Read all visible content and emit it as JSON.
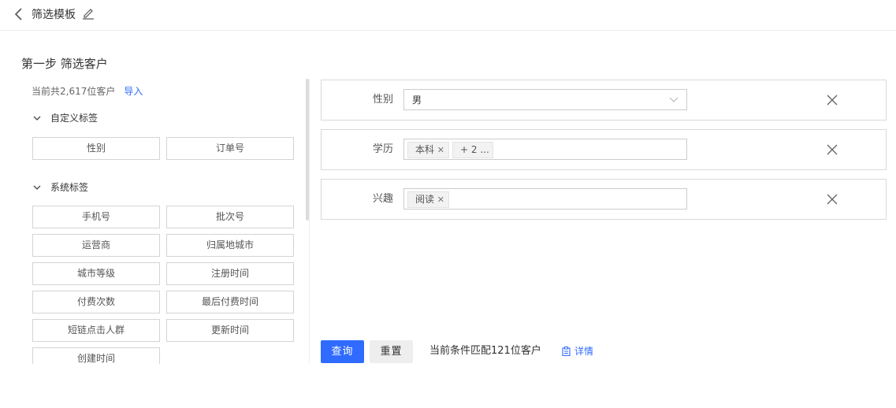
{
  "header": {
    "title": "筛选模板",
    "back_icon": "chevron-left-icon",
    "edit_icon": "pencil-icon"
  },
  "step": {
    "title": "第一步 筛选客户"
  },
  "left": {
    "count_text": "当前共2,617位客户",
    "import_label": "导入",
    "custom_group": {
      "label": "自定义标签",
      "tags": [
        "性别",
        "订单号"
      ]
    },
    "system_group": {
      "label": "系统标签",
      "tags": [
        "手机号",
        "批次号",
        "运营商",
        "归属地城市",
        "城市等级",
        "注册时间",
        "付费次数",
        "最后付费时间",
        "短链点击人群",
        "更新时间",
        "创建时间"
      ]
    }
  },
  "conditions": [
    {
      "label": "性别",
      "value": "男"
    },
    {
      "label": "学历",
      "chips": [
        "本科",
        "+ 2 ..."
      ]
    },
    {
      "label": "兴趣",
      "chips": [
        "阅读"
      ]
    }
  ],
  "footer": {
    "query_label": "查询",
    "reset_label": "重置",
    "match_text": "当前条件匹配121位客户",
    "detail_label": "详情"
  },
  "colors": {
    "primary": "#2f6bff",
    "border": "#d9d9d9",
    "text": "#333333"
  }
}
